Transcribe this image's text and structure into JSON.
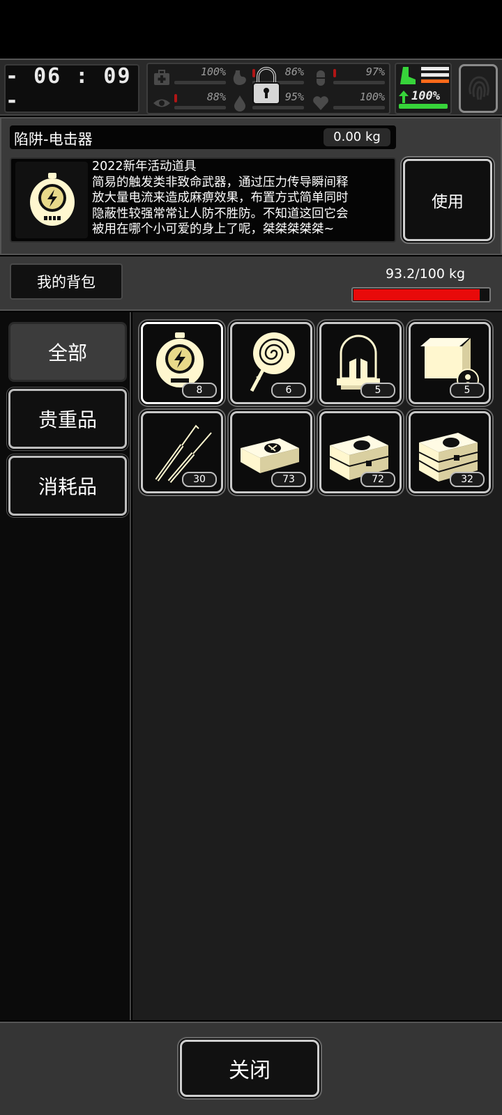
{
  "status": {
    "clock": "- 06 : 09 -",
    "vitals": [
      {
        "name": "health",
        "icon": "medkit-icon",
        "value": "100%"
      },
      {
        "name": "hunger",
        "icon": "stomach-icon",
        "value": "86%"
      },
      {
        "name": "energy",
        "icon": "pill-icon",
        "value": "97%"
      },
      {
        "name": "vision",
        "icon": "eye-icon",
        "value": "88%"
      },
      {
        "name": "water",
        "icon": "water-drop-icon",
        "value": "95%"
      },
      {
        "name": "heart",
        "icon": "heart-icon",
        "value": "100%"
      }
    ],
    "stamina_value": "100%",
    "stamina_level": 1.0
  },
  "item": {
    "name": "陷阱-电击器",
    "weight": "0.00 kg",
    "description": "2022新年活动道具\n简易的触发类非致命武器，通过压力传导瞬间释\n放大量电流来造成麻痹效果，布置方式简单同时\n隐蔽性较强常常让人防不胜防。不知道这回它会\n被用在哪个小可爱的身上了呢，桀桀桀桀桀~",
    "use_label": "使用"
  },
  "bag": {
    "tab_label": "我的背包",
    "weight": "93.2/100 kg",
    "fill": 0.932
  },
  "categories": [
    {
      "label": "全部",
      "active": true
    },
    {
      "label": "贵重品",
      "active": false
    },
    {
      "label": "消耗品",
      "active": false
    }
  ],
  "items": [
    {
      "icon": "shock-trap-icon",
      "count": "8"
    },
    {
      "icon": "lollipop-icon",
      "count": "6"
    },
    {
      "icon": "alarm-beacon-icon",
      "count": "5"
    },
    {
      "icon": "locked-crate-icon",
      "count": "5"
    },
    {
      "icon": "lockpick-icon",
      "count": "30"
    },
    {
      "icon": "supply-box-icon",
      "count": "73"
    },
    {
      "icon": "supply-case-icon",
      "count": "72"
    },
    {
      "icon": "supply-stack-icon",
      "count": "32"
    }
  ],
  "close_label": "关闭",
  "colors": {
    "accent": "#fff7cf",
    "bag_fill": "#e80a0a",
    "stamina": "#37d43a"
  }
}
